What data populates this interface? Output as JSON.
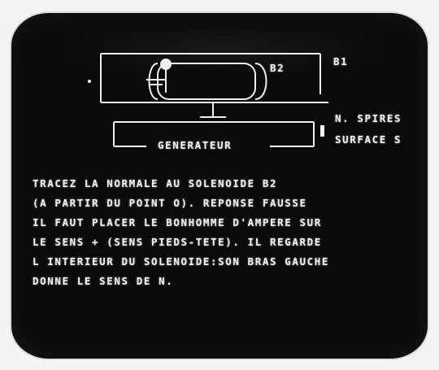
{
  "diagram": {
    "label_b2": "B2",
    "label_b1": "B1",
    "label_generateur": "GENERATEUR",
    "label_spires": "N. SPIRES",
    "label_surface": "SURFACE S"
  },
  "message": {
    "lines": [
      "TRACEZ LA NORMALE AU SOLENOIDE B2",
      "(A PARTIR DU POINT O). REPONSE FAUSSE",
      "IL FAUT PLACER LE BONHOMME D'AMPERE SUR",
      "LE SENS + (SENS PIEDS-TETE). IL REGARDE",
      "L INTERIEUR DU SOLENOIDE:SON BRAS GAUCHE",
      "DONNE LE SENS DE N."
    ]
  },
  "colors": {
    "screen_bg": "#0a0a0a",
    "phosphor": "#f0f0f0",
    "bezel": "#f4f4f2"
  }
}
